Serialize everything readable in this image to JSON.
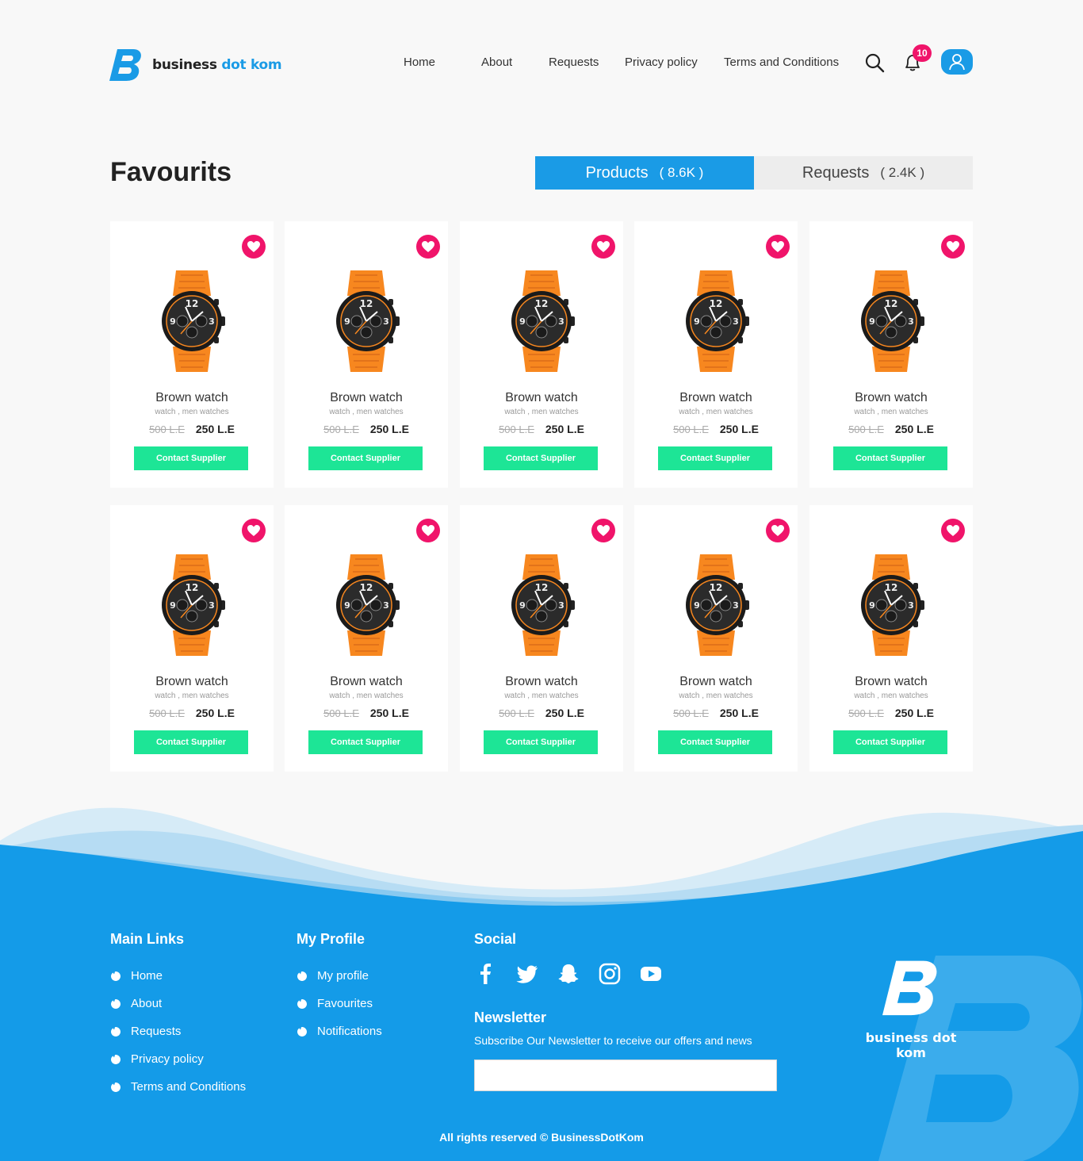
{
  "brand": {
    "name_part1": "business ",
    "name_part2": "dot kom"
  },
  "nav": {
    "items": [
      "Home",
      "About",
      "Requests",
      "Privacy policy",
      "Terms and Conditions"
    ]
  },
  "notifications": {
    "count": "10"
  },
  "page": {
    "title": "Favourits"
  },
  "tabs": [
    {
      "label": "Products",
      "count": "( 8.6K )",
      "active": true
    },
    {
      "label": "Requests",
      "count": "( 2.4K )",
      "active": false
    }
  ],
  "products": [
    {
      "name": "Brown watch",
      "tags": "watch , men watches",
      "old_price": "500 L.E",
      "price": "250 L.E",
      "button": "Contact Supplier"
    },
    {
      "name": "Brown watch",
      "tags": "watch , men watches",
      "old_price": "500 L.E",
      "price": "250 L.E",
      "button": "Contact Supplier"
    },
    {
      "name": "Brown watch",
      "tags": "watch , men watches",
      "old_price": "500 L.E",
      "price": "250 L.E",
      "button": "Contact Supplier"
    },
    {
      "name": "Brown watch",
      "tags": "watch , men watches",
      "old_price": "500 L.E",
      "price": "250 L.E",
      "button": "Contact Supplier"
    },
    {
      "name": "Brown watch",
      "tags": "watch , men watches",
      "old_price": "500 L.E",
      "price": "250 L.E",
      "button": "Contact Supplier"
    },
    {
      "name": "Brown watch",
      "tags": "watch , men watches",
      "old_price": "500 L.E",
      "price": "250 L.E",
      "button": "Contact Supplier"
    },
    {
      "name": "Brown watch",
      "tags": "watch , men watches",
      "old_price": "500 L.E",
      "price": "250 L.E",
      "button": "Contact Supplier"
    },
    {
      "name": "Brown watch",
      "tags": "watch , men watches",
      "old_price": "500 L.E",
      "price": "250 L.E",
      "button": "Contact Supplier"
    },
    {
      "name": "Brown watch",
      "tags": "watch , men watches",
      "old_price": "500 L.E",
      "price": "250 L.E",
      "button": "Contact Supplier"
    },
    {
      "name": "Brown watch",
      "tags": "watch , men watches",
      "old_price": "500 L.E",
      "price": "250 L.E",
      "button": "Contact Supplier"
    }
  ],
  "footer": {
    "main_links": {
      "title": "Main Links",
      "items": [
        "Home",
        "About",
        "Requests",
        "Privacy policy",
        "Terms and Conditions"
      ]
    },
    "my_profile": {
      "title": "My Profile",
      "items": [
        "My profile",
        "Favourites",
        "Notifications"
      ]
    },
    "social": {
      "title": "Social",
      "icons": [
        "facebook-icon",
        "twitter-icon",
        "snapchat-icon",
        "instagram-icon",
        "youtube-icon"
      ]
    },
    "newsletter": {
      "title": "Newsletter",
      "subtitle": "Subscribe Our Newsletter to receive our offers and news",
      "placeholder": ""
    },
    "logo_text": "business dot kom",
    "copyright": "All rights reserved © BusinessDotKom"
  },
  "colors": {
    "primary": "#1a9be6",
    "accent_pink": "#f0146a",
    "button_green": "#1de596",
    "watch_orange": "#f7871f"
  }
}
